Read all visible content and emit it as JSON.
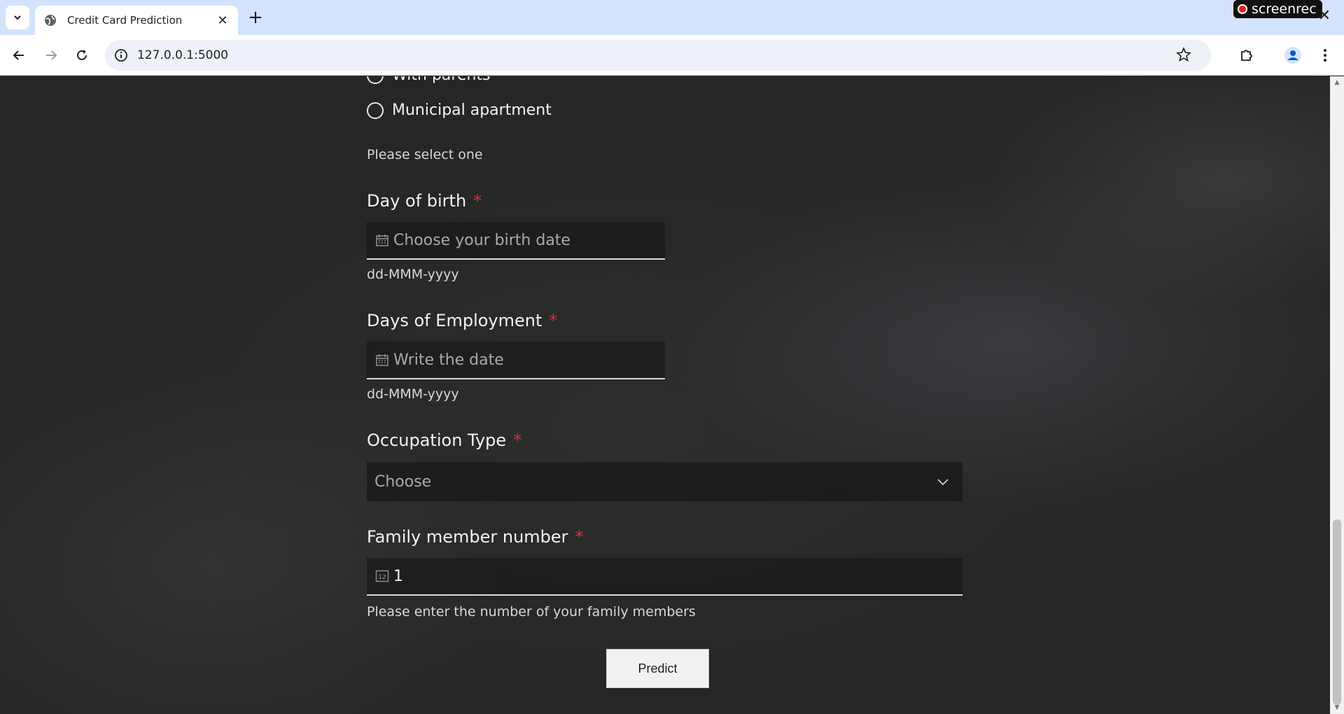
{
  "browser": {
    "tab_title": "Credit Card Prediction",
    "new_tab_symbol": "+",
    "close_symbol": "✕",
    "url": "127.0.0.1:5000",
    "recorder_label": "screenrec"
  },
  "form": {
    "residence_options": [
      {
        "label": "With parents"
      },
      {
        "label": "Municipal apartment"
      }
    ],
    "residence_helper": "Please select one",
    "birth": {
      "label": "Day of birth",
      "required_mark": "*",
      "placeholder": "Choose your birth date",
      "helper": "dd-MMM-yyyy"
    },
    "employment": {
      "label": "Days of Employment",
      "required_mark": "*",
      "placeholder": "Write the date",
      "helper": "dd-MMM-yyyy"
    },
    "occupation": {
      "label": "Occupation Type",
      "required_mark": "*",
      "placeholder": "Choose"
    },
    "family": {
      "label": "Family member number",
      "required_mark": "*",
      "value": "1",
      "helper": "Please enter the number of your family members"
    },
    "submit_label": "Predict"
  },
  "icons": {
    "calendar": "calendar-icon",
    "number": "number-icon",
    "chevron": "chevron-down-icon"
  },
  "colors": {
    "tabstrip": "#d3e3fd",
    "required": "#d0343c",
    "background": "#262626"
  }
}
